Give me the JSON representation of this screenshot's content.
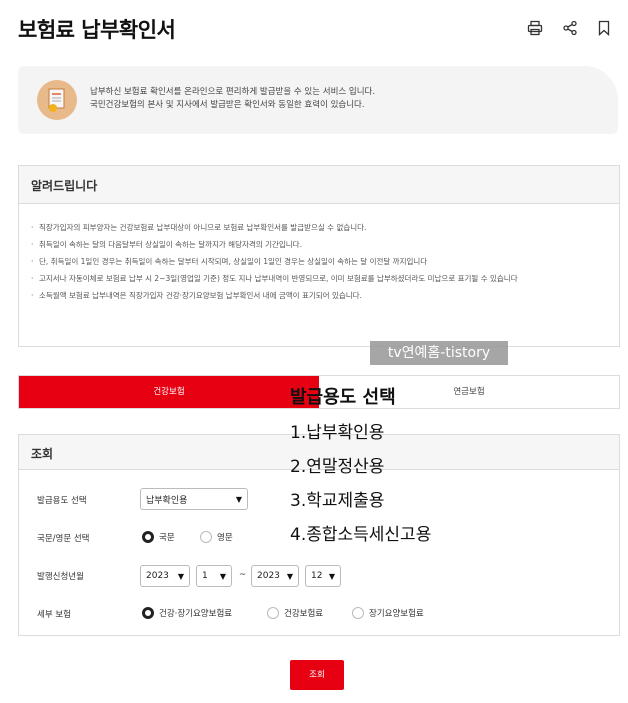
{
  "header": {
    "title": "보험료 납부확인서",
    "icons": [
      "print-icon",
      "share-icon",
      "bookmark-icon"
    ]
  },
  "intro": {
    "lines": [
      "납부하신 보험료 확인서를 온라인으로 편리하게 발급받을 수 있는 서비스 입니다.",
      "국민건강보험의 본사 및 지사에서 발급받은 확인서와 동일한 효력이 있습니다."
    ]
  },
  "notice": {
    "title": "알려드립니다",
    "items": [
      "직장가입자의 피부양자는 건강보험료 납부대상이 아니므로 보험료 납부확인서를 발급받으실 수 없습니다.",
      "취득일이 속하는 달의 다음달부터 상실일이 속하는 달까지가 해당자격의 기간입니다.",
      "단, 취득일이 1일인 경우는 취득일이 속하는 달부터 시작되며, 상실일이 1일인 경우는 상실일이 속하는 달 이전달 까지입니다",
      "고지서나 자동이체로 보험료 납부 시 2~3일(영업일 기준) 정도 지나 납부내역이 반영되므로, 이미 보험료를 납부하셨더라도 미납으로 표기될 수 있습니다",
      "소득월액 보험료 납부내역은 직장가입자 건강·장기요양보험 납부확인서 내에 금액이 표기되어 있습니다."
    ]
  },
  "watermark": "tv연예홈-tistory",
  "tabs": {
    "active": "건강보험",
    "inactive": "연금보험"
  },
  "query": {
    "title": "조회",
    "purpose_label": "발급용도 선택",
    "purpose_value": "납부확인용",
    "language_label": "국문/영문 선택",
    "language_options": [
      "국문",
      "영문"
    ],
    "period_label": "발행신청년월",
    "start_year": "2023",
    "start_month": "1",
    "separator": "~",
    "end_year": "2023",
    "end_month": "12",
    "detail_label": "세부 보험",
    "detail_options": [
      "건강·장기요양보험료",
      "건강보험료",
      "장기요양보험료"
    ],
    "submit_label": "조회"
  },
  "overlay": {
    "title": "발급용도 선택",
    "items": [
      "1.납부확인용",
      "2.연말정산용",
      "3.학교제출용",
      "4.종합소득세신고용"
    ]
  },
  "colors": {
    "accent": "#e60012",
    "panel_bg": "#f4f4f4",
    "border": "#dcdcdc"
  }
}
